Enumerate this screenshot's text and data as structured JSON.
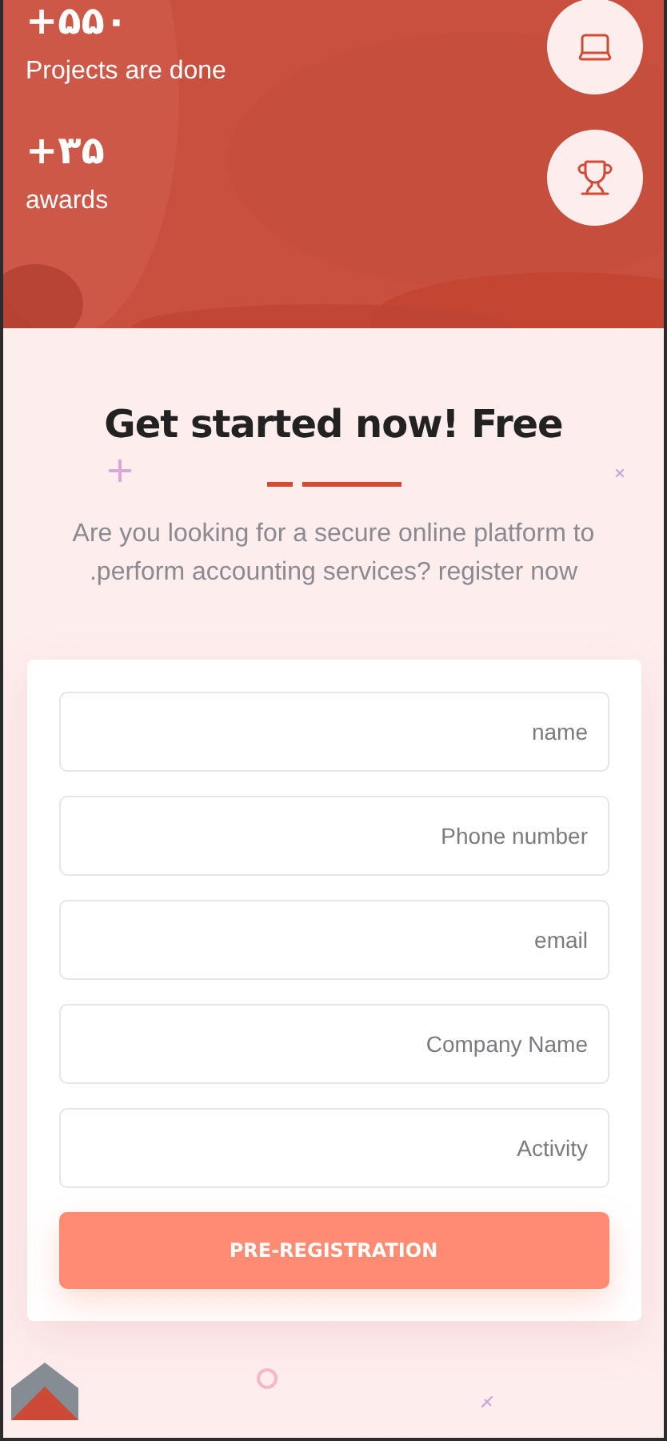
{
  "stats": [
    {
      "kind": "laptop",
      "value": "+۵۵۰",
      "label": "Projects are done"
    },
    {
      "kind": "trophy",
      "value": "+۳۵",
      "label": "awards"
    }
  ],
  "signup": {
    "title": "Get started now! Free",
    "description": "Are you looking for a secure online platform to .perform accounting services? register now",
    "fields": [
      {
        "placeholder": "name"
      },
      {
        "placeholder": "Phone number"
      },
      {
        "placeholder": "email"
      },
      {
        "placeholder": "Company Name"
      },
      {
        "placeholder": "Activity"
      }
    ],
    "submit": "PRE-REGISTRATION"
  }
}
